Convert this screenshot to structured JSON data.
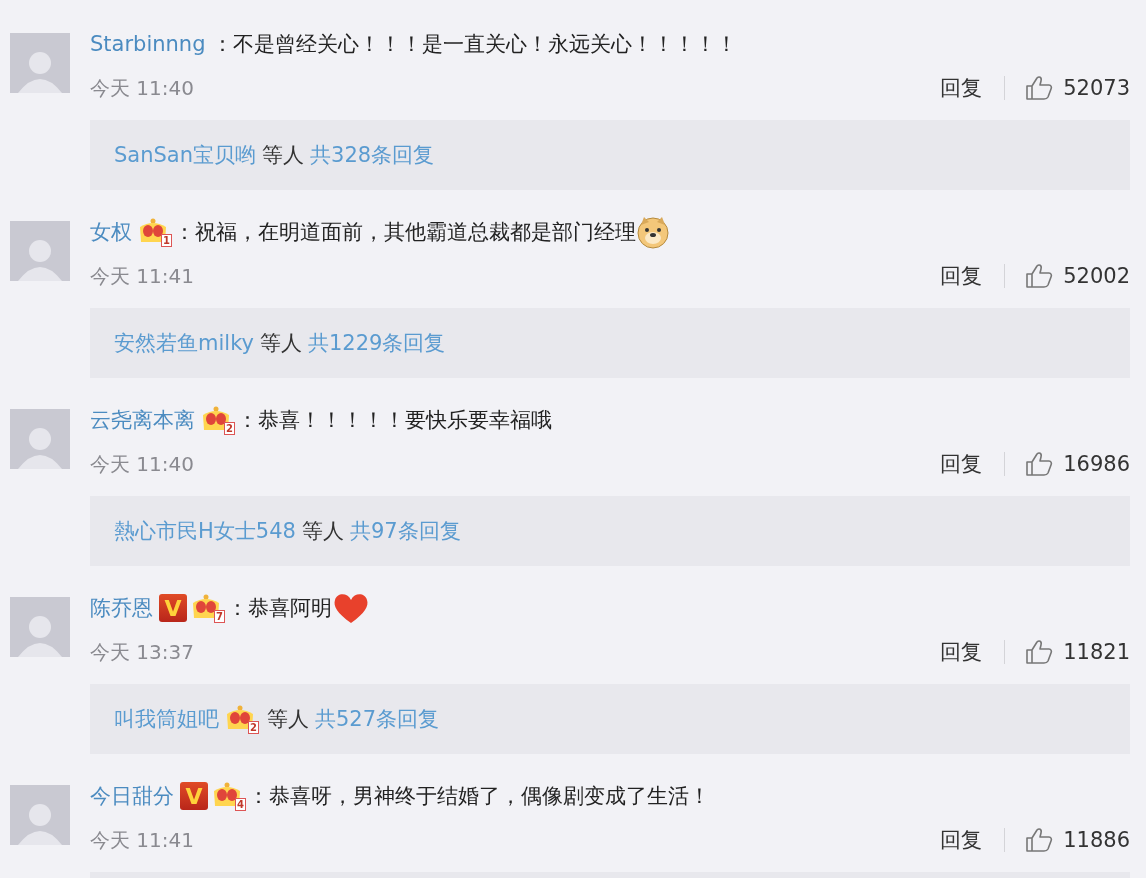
{
  "comments": [
    {
      "author": "Starbinnng",
      "text": "：不是曾经关心！！！是一直关心！永远关心！！！！！",
      "time": "今天 11:40",
      "reply_label": "回复",
      "likes": "52073",
      "replies": {
        "user": "SanSan宝贝哟",
        "suffix": "等人",
        "total": "共328条回复"
      }
    },
    {
      "author": "女权",
      "badges": [
        {
          "kind": "crown",
          "text": "1"
        }
      ],
      "text": "：祝福，在明道面前，其他霸道总裁都是部门经理",
      "emoji": {
        "kind": "doge"
      },
      "time": "今天 11:41",
      "reply_label": "回复",
      "likes": "52002",
      "replies": {
        "user": "安然若鱼milky",
        "suffix": "等人",
        "total": "共1229条回复"
      }
    },
    {
      "author": "云尧离本离",
      "badges": [
        {
          "kind": "crown",
          "text": "2"
        }
      ],
      "text": "：恭喜！！！！！要快乐要幸福哦",
      "time": "今天 11:40",
      "reply_label": "回复",
      "likes": "16986",
      "replies": {
        "user": "熱心市民H女士548",
        "suffix": "等人",
        "total": "共97条回复"
      }
    },
    {
      "author": "陈乔恩",
      "badges": [
        {
          "kind": "verified",
          "text": "V"
        },
        {
          "kind": "crown",
          "text": "7"
        }
      ],
      "text": "：恭喜阿明",
      "emoji": {
        "kind": "heart"
      },
      "time": "今天 13:37",
      "reply_label": "回复",
      "likes": "11821",
      "replies": {
        "user": "叫我筒姐吧",
        "user_badges": [
          {
            "kind": "crown",
            "text": "2"
          }
        ],
        "suffix": "等人",
        "total": "共527条回复"
      }
    },
    {
      "author": "今日甜分",
      "badges": [
        {
          "kind": "verified",
          "text": "V"
        },
        {
          "kind": "crown",
          "text": "4"
        }
      ],
      "text": "：恭喜呀，男神终于结婚了，偶像剧变成了生活！",
      "time": "今天 11:41",
      "reply_label": "回复",
      "likes": "11886"
    }
  ]
}
